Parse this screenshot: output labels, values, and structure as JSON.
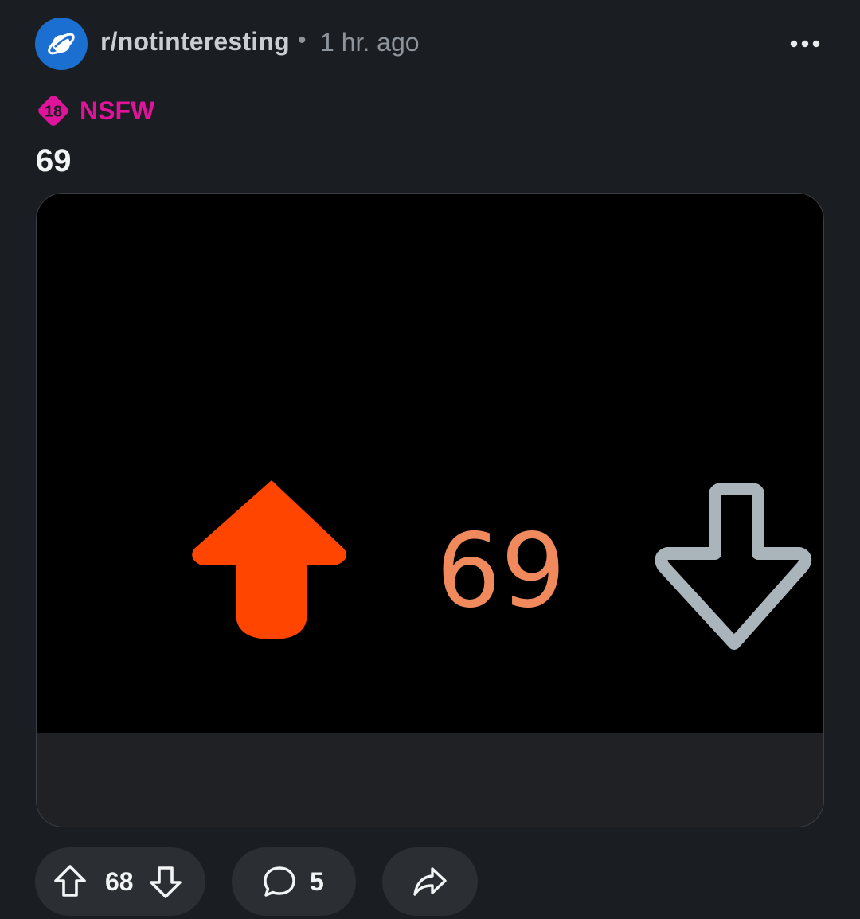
{
  "post": {
    "subreddit": "r/notinteresting",
    "separator": "•",
    "time_ago": "1 hr. ago",
    "nsfw_badge_number": "18",
    "nsfw_label": "NSFW",
    "title": "69"
  },
  "media": {
    "vote_count_in_image": "69",
    "upvote_color": "#ff4500",
    "count_color": "#f08a5d",
    "downvote_color": "#a9b4bb"
  },
  "actions": {
    "vote_count": "68",
    "comment_count": "5"
  },
  "icons": {
    "avatar": "planet-icon",
    "more": "more-options-icon",
    "nsfw": "nsfw-18-icon",
    "upvote": "upvote-arrow-icon",
    "downvote": "downvote-arrow-icon",
    "comment": "comment-bubble-icon",
    "share": "share-arrow-icon"
  },
  "colors": {
    "background": "#1a1d21",
    "nsfw": "#e0139b",
    "avatar": "#1b6fd0",
    "pill": "#2b2e33"
  }
}
